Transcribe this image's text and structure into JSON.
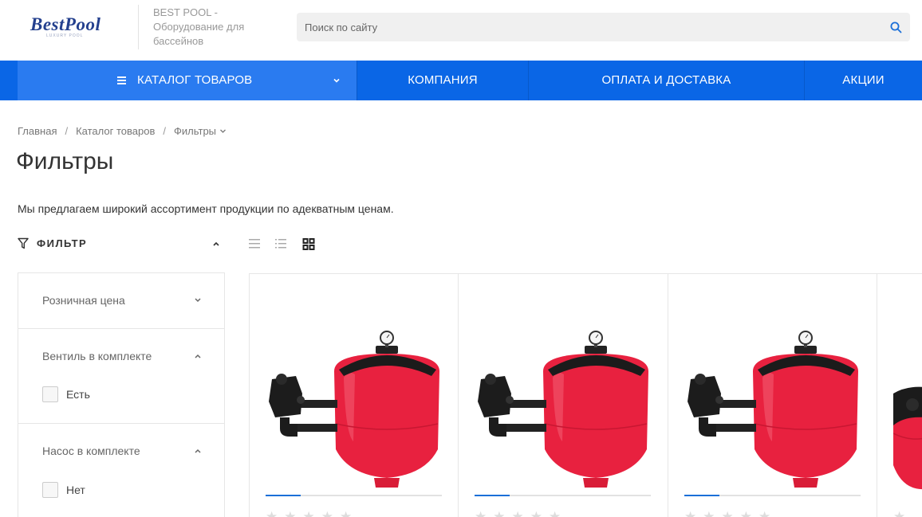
{
  "header": {
    "logo_text": "BestPool",
    "logo_sub": "LUXURY POOL",
    "tagline": "BEST POOL - Оборудование для бассейнов",
    "search_placeholder": "Поиск по сайту"
  },
  "nav": {
    "catalog": "КАТАЛОГ ТОВАРОВ",
    "company": "КОМПАНИЯ",
    "payment": "ОПЛАТА И ДОСТАВКА",
    "promo": "АКЦИИ"
  },
  "breadcrumb": [
    "Главная",
    "Каталог товаров",
    "Фильтры"
  ],
  "page_title": "Фильтры",
  "intro": "Мы предлагаем широкий ассортимент продукции по адекватным ценам.",
  "filter": {
    "title": "ФИЛЬТР",
    "sections": [
      {
        "title": "Розничная цена",
        "options": []
      },
      {
        "title": "Вентиль в комплекте",
        "options": [
          "Есть"
        ]
      },
      {
        "title": "Насос в комплекте",
        "options": [
          "Нет"
        ]
      }
    ]
  },
  "colors": {
    "nav_bg": "#0a66e6",
    "nav_catalog_bg": "#2a7bf0",
    "filter_tank": "#e8213f",
    "accent_bar": "#1b6fd8"
  },
  "icons": {
    "search": "search-icon",
    "menu": "menu-icon",
    "filter": "filter-icon",
    "view_list": "view-list-icon",
    "view_detail": "view-detail-icon",
    "view_grid": "view-grid-icon",
    "rating": "star-icon"
  }
}
